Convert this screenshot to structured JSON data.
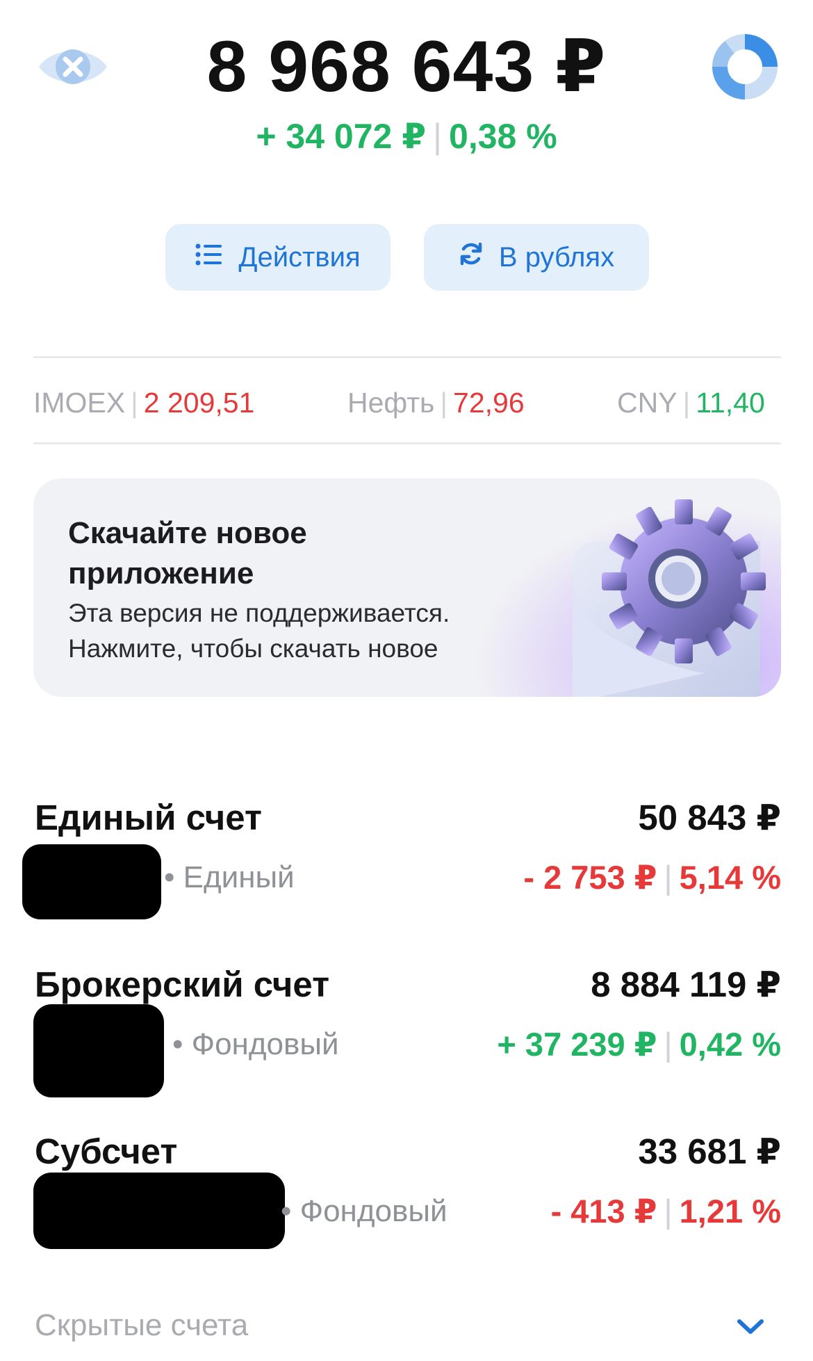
{
  "header": {
    "total": "8 968 643 ₽",
    "change_abs": "+ 34 072 ₽",
    "change_pct": "0,38 %"
  },
  "actions": {
    "actions_label": "Действия",
    "currency_label": "В рублях"
  },
  "tickers": [
    {
      "name": "IMOEX",
      "value": "2 209,51",
      "color": "#e5393a"
    },
    {
      "name": "Нефть",
      "value": "72,96",
      "color": "#e5393a"
    },
    {
      "name": "CNY",
      "value": "11,40",
      "color": "#21b563"
    }
  ],
  "banner": {
    "title": "Скачайте новое приложение",
    "line1": "Эта версия не поддерживается.",
    "line2": "Нажмите, чтобы скачать новое"
  },
  "accounts": [
    {
      "name": "Единый счет",
      "value": "50 843 ₽",
      "type": "• Единый",
      "change_abs": "- 2 753 ₽",
      "change_pct": "5,14 %",
      "trend": "down"
    },
    {
      "name": "Брокерский счет",
      "value": "8 884 119 ₽",
      "type": "• Фондовый",
      "change_abs": "+ 37 239 ₽",
      "change_pct": "0,42 %",
      "trend": "up"
    },
    {
      "name": "Субсчет",
      "value": "33 681 ₽",
      "type": "• Фондовый",
      "change_abs": "- 413 ₽",
      "change_pct": "1,21 %",
      "trend": "down"
    }
  ],
  "footer": {
    "hidden_accounts": "Скрытые счета"
  },
  "colors": {
    "positive": "#21b563",
    "negative": "#e5393a",
    "accent": "#1f74d8"
  },
  "icons": [
    "eye-hide-icon",
    "portfolio-donut-icon",
    "list-icon",
    "refresh-icon",
    "gear-illustration",
    "chevron-down-icon"
  ]
}
